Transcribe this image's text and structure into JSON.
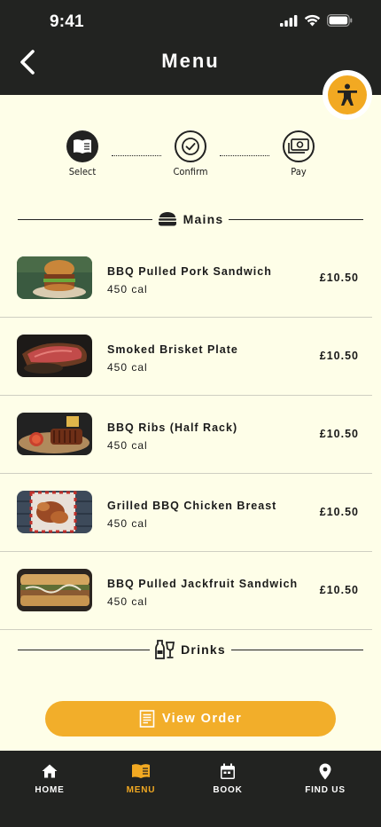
{
  "status_bar": {
    "time": "9:41"
  },
  "header": {
    "title": "Menu"
  },
  "steps": [
    {
      "label": "Select",
      "state": "active"
    },
    {
      "label": "Confirm",
      "state": "outline"
    },
    {
      "label": "Pay",
      "state": "outline"
    }
  ],
  "sections": {
    "mains": "Mains",
    "drinks": "Drinks"
  },
  "items": [
    {
      "name": "BBQ Pulled Pork Sandwich",
      "cal": "450 cal",
      "price": "£10.50"
    },
    {
      "name": "Smoked Brisket Plate",
      "cal": "450 cal",
      "price": "£10.50"
    },
    {
      "name": "BBQ Ribs (Half Rack)",
      "cal": "450 cal",
      "price": "£10.50"
    },
    {
      "name": "Grilled BBQ Chicken Breast",
      "cal": "450 cal",
      "price": "£10.50"
    },
    {
      "name": "BBQ Pulled Jackfruit Sandwich",
      "cal": "450 cal",
      "price": "£10.50"
    }
  ],
  "order_button": {
    "label": "View Order"
  },
  "nav": [
    {
      "label": "HOME",
      "icon": "home-icon"
    },
    {
      "label": "MENU",
      "icon": "menu-book-icon",
      "active": true
    },
    {
      "label": "BOOK",
      "icon": "calendar-icon"
    },
    {
      "label": "FIND US",
      "icon": "location-pin-icon"
    }
  ],
  "colors": {
    "accent": "#f2a922",
    "dark": "#222321",
    "background": "#fefee8"
  }
}
